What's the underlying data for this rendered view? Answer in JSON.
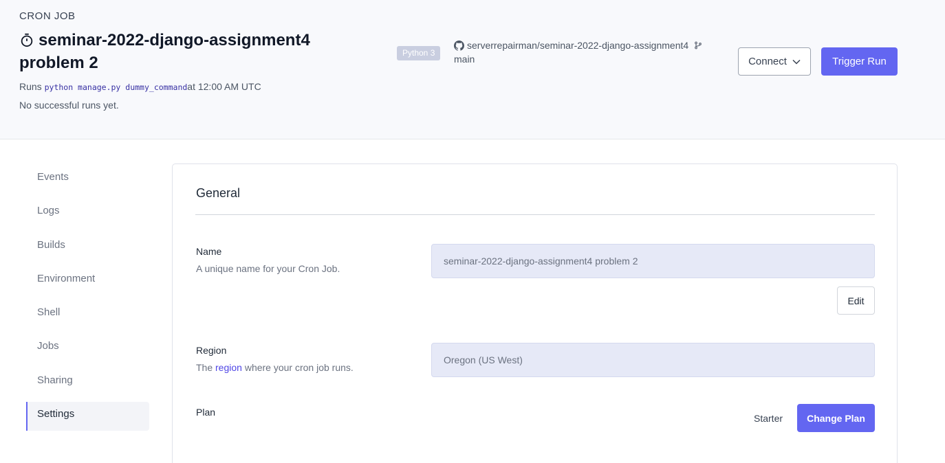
{
  "header": {
    "kind": "CRON JOB",
    "title": "seminar-2022-django-assignment4 problem 2",
    "runs_prefix": "Runs",
    "command": "python manage.py dummy_command",
    "schedule_suffix": "at 12:00 AM UTC",
    "status": "No successful runs yet.",
    "language": "Python 3",
    "repo": "serverrepairman/seminar-2022-django-assignment4",
    "branch": "main",
    "connect_label": "Connect",
    "trigger_label": "Trigger Run",
    "icons": {
      "title": "stopwatch-icon",
      "repo": "github-icon",
      "branch": "git-branch-icon",
      "connect": "chevron-down-icon"
    }
  },
  "sidebar": {
    "items": [
      {
        "label": "Events"
      },
      {
        "label": "Logs"
      },
      {
        "label": "Builds"
      },
      {
        "label": "Environment"
      },
      {
        "label": "Shell"
      },
      {
        "label": "Jobs"
      },
      {
        "label": "Sharing"
      },
      {
        "label": "Settings",
        "active": true
      }
    ]
  },
  "general": {
    "title": "General",
    "name": {
      "label": "Name",
      "description": "A unique name for your Cron Job.",
      "value": "seminar-2022-django-assignment4 problem 2",
      "edit_label": "Edit"
    },
    "region": {
      "label": "Region",
      "desc_prefix": "The",
      "desc_link": "region",
      "desc_suffix": "where your cron job runs.",
      "value": "Oregon (US West)"
    },
    "plan": {
      "label": "Plan",
      "value": "Starter",
      "change_label": "Change Plan"
    }
  },
  "colors": {
    "accent": "#6366f1",
    "header_bg": "#f8f9fc",
    "input_bg": "#e6e9f7",
    "link": "#4f46e5"
  }
}
